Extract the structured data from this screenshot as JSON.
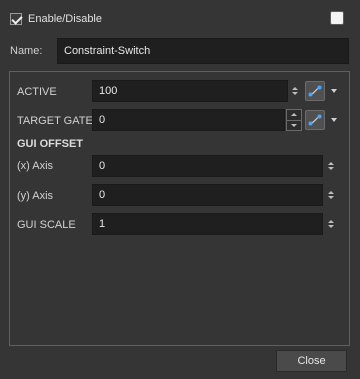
{
  "header": {
    "enable_label": "Enable/Disable",
    "enabled": true,
    "swatch_color": "#f4f4f4"
  },
  "name": {
    "label": "Name:",
    "value": "Constraint-Switch"
  },
  "rows": {
    "active": {
      "label": "ACTIVE",
      "value": "100"
    },
    "target_gate": {
      "label": "TARGET GATE",
      "value": "0"
    },
    "gui_offset": {
      "label": "GUI OFFSET"
    },
    "x_axis": {
      "label": "(x) Axis",
      "value": "0"
    },
    "y_axis": {
      "label": "(y) Axis",
      "value": "0"
    },
    "gui_scale": {
      "label": "GUI SCALE",
      "value": "1"
    }
  },
  "footer": {
    "close_label": "Close"
  },
  "colors": {
    "background": "#353535",
    "field": "#1f1f1f",
    "function_dot": "#4aa3ff"
  },
  "icons": {
    "function_icon": "function-curve-icon",
    "dropdown_icon": "caret-down-icon"
  }
}
